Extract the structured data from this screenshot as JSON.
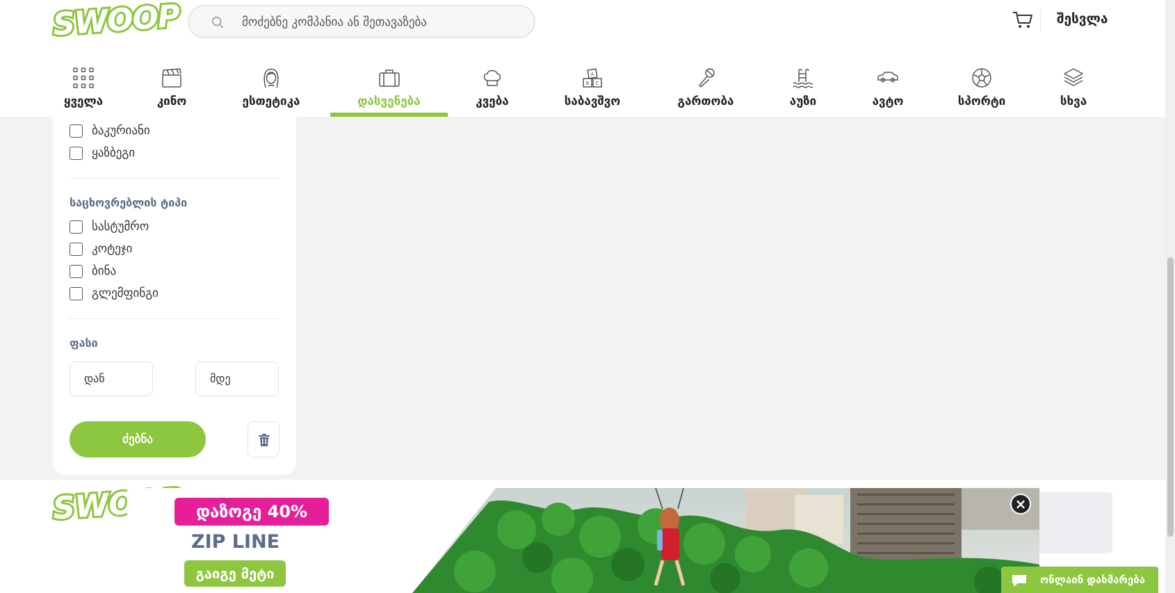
{
  "brand": {
    "logo_text": "SWOOP",
    "accent_color": "#8dc63f",
    "promo_pink": "#e61e9a"
  },
  "header": {
    "search_placeholder": "მოძებნე კომპანია ან შეთავაზება",
    "search_icon": "search-icon",
    "cart_icon": "cart-icon",
    "login_label": "შესვლა"
  },
  "nav": {
    "active_index": 3,
    "items": [
      {
        "label": "ყველა",
        "icon": "grid-icon"
      },
      {
        "label": "კინო",
        "icon": "clapperboard-icon"
      },
      {
        "label": "ესთეტიკა",
        "icon": "woman-face-icon"
      },
      {
        "label": "დასვენება",
        "icon": "suitcase-icon"
      },
      {
        "label": "კვება",
        "icon": "chef-hat-icon"
      },
      {
        "label": "საბავშვო",
        "icon": "toy-blocks-icon"
      },
      {
        "label": "გართობა",
        "icon": "microphone-icon"
      },
      {
        "label": "აუზი",
        "icon": "pool-ladder-icon"
      },
      {
        "label": "ავტო",
        "icon": "car-icon"
      },
      {
        "label": "სპორტი",
        "icon": "soccer-ball-icon"
      },
      {
        "label": "სხვა",
        "icon": "layers-icon"
      }
    ]
  },
  "filters": {
    "locations": [
      {
        "label": "ბაკურიანი",
        "checked": false
      },
      {
        "label": "ყაზბეგი",
        "checked": false
      }
    ],
    "accommodation_title": "საცხოვრებლის ტიპი",
    "accommodation_types": [
      {
        "label": "სასტუმრო",
        "checked": false
      },
      {
        "label": "კოტეჯი",
        "checked": false
      },
      {
        "label": "ბინა",
        "checked": false
      },
      {
        "label": "გლემფინგი",
        "checked": false
      }
    ],
    "price_title": "ფასი",
    "price_from_placeholder": "დან",
    "price_separator": "-",
    "price_to_placeholder": "მდე",
    "search_button": "ძებნა",
    "clear_icon": "trash-icon"
  },
  "footer": {
    "logo_text": "SWOOP"
  },
  "promo": {
    "discount_label": "დაზოგე 40%",
    "title": "ZIP LINE",
    "button_label": "გაიგე მეტი",
    "close_symbol": "×"
  },
  "chat": {
    "label": "ონლაინ დახმარება",
    "icon": "chat-bubble-icon"
  }
}
